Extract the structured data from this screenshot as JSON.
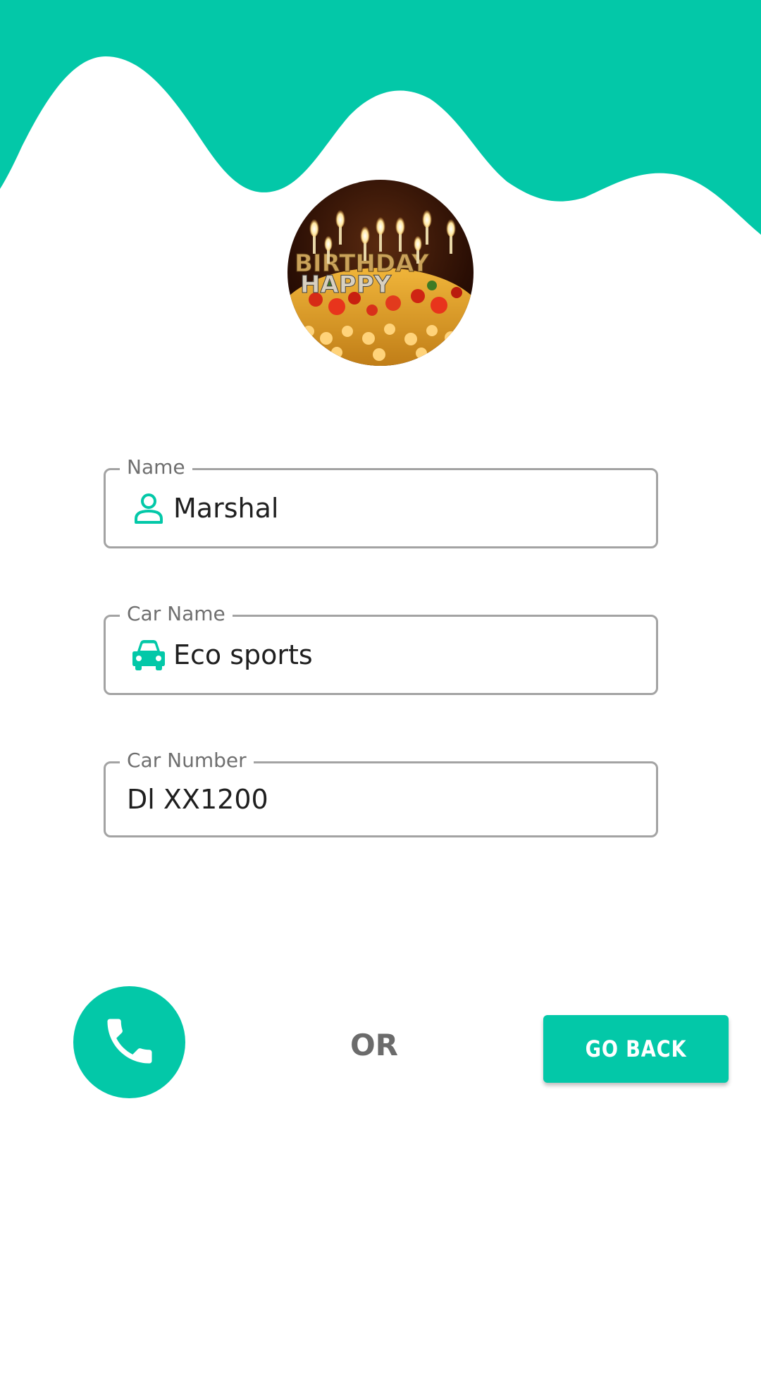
{
  "theme": {
    "accent": "#03c8a8",
    "field_border": "#a3a3a3",
    "label_color": "#6f6f6f",
    "value_color": "#1f1f1f"
  },
  "header": {
    "avatar_image": "birthday-cake-with-candles"
  },
  "form": {
    "name": {
      "label": "Name",
      "value": "Marshal",
      "icon": "person-icon"
    },
    "car_name": {
      "label": "Car Name",
      "value": "Eco sports",
      "icon": "car-icon"
    },
    "car_number": {
      "label": "Car Number",
      "value": "Dl XX1200"
    }
  },
  "actions": {
    "call_icon": "phone-icon",
    "or_text": "OR",
    "go_back_label": "GO BACK"
  }
}
